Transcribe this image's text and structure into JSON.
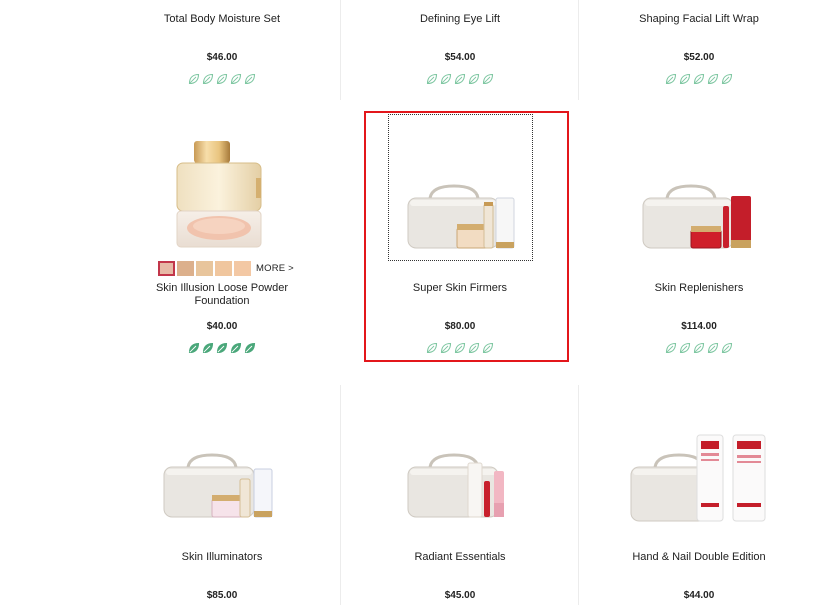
{
  "products": [
    {
      "name": "Total Body Moisture Set",
      "price": "$46.00",
      "rating": 0
    },
    {
      "name": "Defining Eye Lift",
      "price": "$54.00",
      "rating": 0
    },
    {
      "name": "Shaping Facial Lift Wrap",
      "price": "$52.00",
      "rating": 0
    },
    {
      "name": "Skin Illusion Loose Powder Foundation",
      "price": "$40.00",
      "rating": 5,
      "swatches": [
        "#e7b9a6",
        "#dcb08c",
        "#e8c59c",
        "#f0c69e",
        "#f3c8a4"
      ],
      "more_label": "MORE >"
    },
    {
      "name": "Super Skin Firmers",
      "price": "$80.00",
      "rating": 0
    },
    {
      "name": "Skin Replenishers",
      "price": "$114.00",
      "rating": 0
    },
    {
      "name": "Skin Illuminators",
      "price": "$85.00",
      "rating": 0
    },
    {
      "name": "Radiant Essentials",
      "price": "$45.00",
      "rating": 0
    },
    {
      "name": "Hand & Nail Double Edition",
      "price": "$44.00",
      "rating": 0
    }
  ],
  "colors": {
    "leaf_outline": "#7fc7a2",
    "leaf_filled": "#4aa77a",
    "highlight_border": "#e3161b",
    "selected_swatch_border": "#c2364a"
  },
  "icons": {
    "rating": "leaf-icon"
  }
}
